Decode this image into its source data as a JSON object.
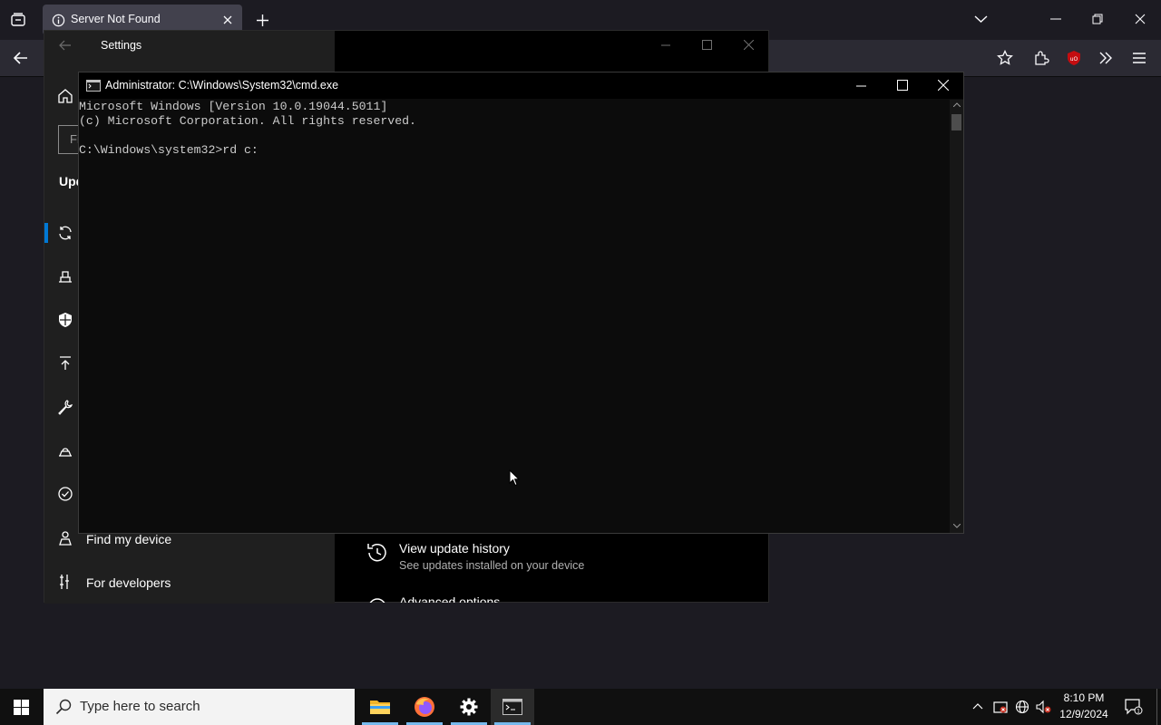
{
  "browser": {
    "tab_title": "Server Not Found"
  },
  "settings": {
    "window_title": "Settings",
    "search_placeholder_fragment": "Fi",
    "section_fragment": "Upd",
    "nav": [
      {
        "label": "Find my device",
        "icon": "person-pin-icon"
      },
      {
        "label": "For developers",
        "icon": "developer-tools-icon"
      }
    ],
    "main": {
      "history_title": "View update history",
      "history_subtitle": "See updates installed on your device",
      "advanced_title": "Advanced options"
    }
  },
  "cmd": {
    "window_title": "Administrator: C:\\Windows\\System32\\cmd.exe",
    "lines": [
      "Microsoft Windows [Version 10.0.19044.5011]",
      "(c) Microsoft Corporation. All rights reserved.",
      "",
      "C:\\Windows\\system32>rd c:"
    ]
  },
  "taskbar": {
    "search_placeholder": "Type here to search",
    "time": "8:10 PM",
    "date": "12/9/2024"
  },
  "colors": {
    "accent": "#0078d4",
    "taskbar_indicator": "#76b9ed"
  }
}
